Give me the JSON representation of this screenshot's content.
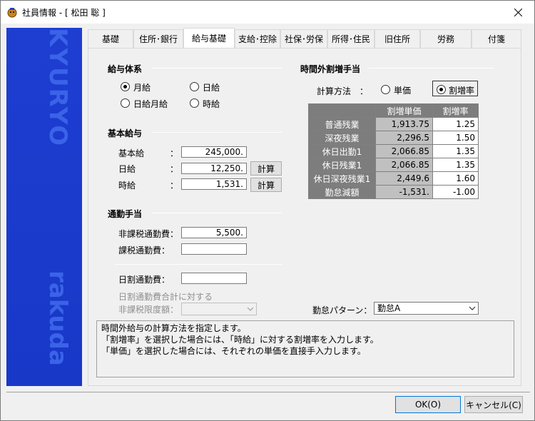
{
  "window": {
    "title": "社員情報 - [ 松田 聡 ]"
  },
  "tabs": [
    {
      "label": "基礎"
    },
    {
      "label": "住所･銀行"
    },
    {
      "label": "給与基礎"
    },
    {
      "label": "支給･控除"
    },
    {
      "label": "社保･労保"
    },
    {
      "label": "所得･住民"
    },
    {
      "label": "旧住所"
    },
    {
      "label": "労務"
    },
    {
      "label": "付箋"
    }
  ],
  "active_tab": "給与基礎",
  "sidebar": {
    "brand_top": "KYURYO",
    "brand_bottom": "rakuda"
  },
  "salary_type": {
    "title": "給与体系",
    "options": [
      {
        "label": "月給",
        "checked": true
      },
      {
        "label": "日給",
        "checked": false
      },
      {
        "label": "日給月給",
        "checked": false
      },
      {
        "label": "時給",
        "checked": false
      }
    ]
  },
  "base_salary": {
    "title": "基本給与",
    "rows": [
      {
        "label": "基本給",
        "colon": "：",
        "value": "245,000."
      },
      {
        "label": "日給",
        "colon": "：",
        "value": "12,250.",
        "button": "計算"
      },
      {
        "label": "時給",
        "colon": "：",
        "value": "1,531.",
        "button": "計算"
      }
    ]
  },
  "commute": {
    "title": "通勤手当",
    "nontaxable_label": "非課税通勤費：",
    "nontaxable_value": "5,500.",
    "taxable_label": "課税通勤費：",
    "taxable_value": "",
    "daily_label": "日割通勤費：",
    "daily_value": "",
    "limit_label_1": "日割通勤費合計に対する",
    "limit_label_2": "非課税限度額：",
    "limit_value": ""
  },
  "overtime": {
    "title": "時間外割増手当",
    "method_label": "計算方法　：",
    "method_options": [
      {
        "label": "単価",
        "checked": false
      },
      {
        "label": "割増率",
        "checked": true
      }
    ],
    "table": {
      "headers": [
        "割増単価",
        "割増率"
      ],
      "rows": [
        {
          "name": "普通残業",
          "unit": "1,913.75",
          "rate": "1.25"
        },
        {
          "name": "深夜残業",
          "unit": "2,296.5",
          "rate": "1.50"
        },
        {
          "name": "休日出勤1",
          "unit": "2,066.85",
          "rate": "1.35"
        },
        {
          "name": "休日残業1",
          "unit": "2,066.85",
          "rate": "1.35"
        },
        {
          "name": "休日深夜残業1",
          "unit": "2,449.6",
          "rate": "1.60"
        },
        {
          "name": "勤怠減額",
          "unit": "-1,531.",
          "rate": "-1.00"
        }
      ]
    }
  },
  "attendance_pattern": {
    "label": "勤怠パターン：",
    "value": "勤怠A"
  },
  "help": {
    "lines": [
      "時間外給与の計算方法を指定します。",
      "「割増率」を選択した場合には、「時給」に対する割増率を入力します。",
      "「単価」を選択した場合には、それぞれの単価を直接手入力します。"
    ]
  },
  "footer": {
    "ok": "OK(O)",
    "cancel": "キャンセル(C)"
  }
}
